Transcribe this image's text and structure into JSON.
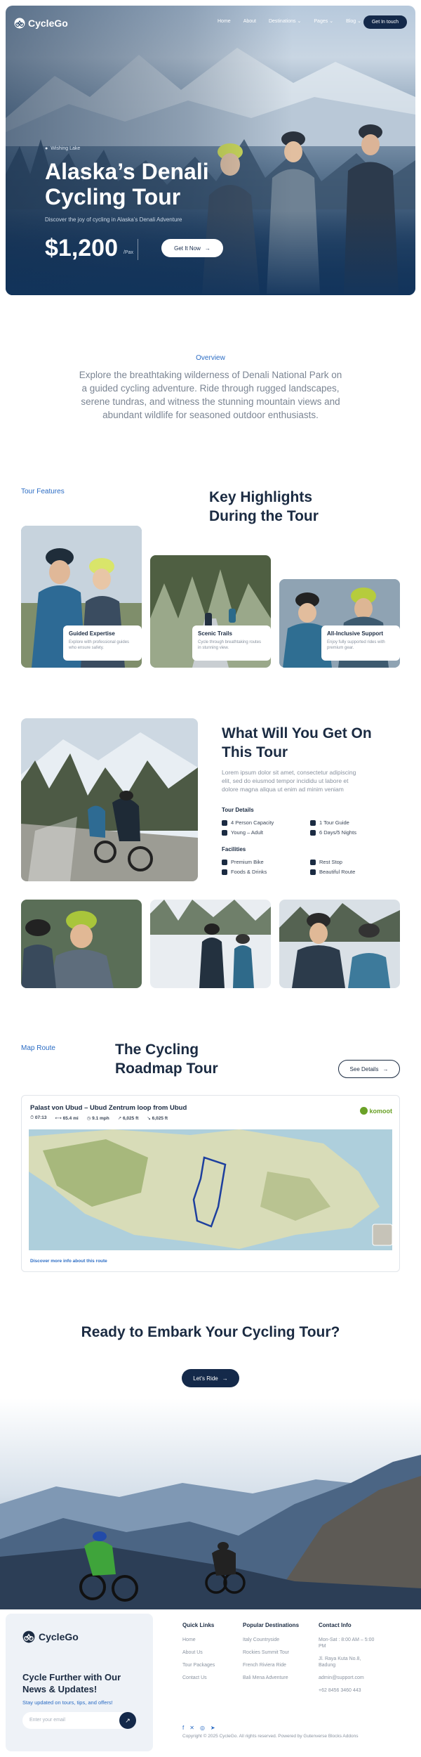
{
  "header": {
    "brand": "CycleGo",
    "nav": [
      "Home",
      "About",
      "Destinations",
      "Pages",
      "Blog"
    ],
    "cta": "Get In touch"
  },
  "hero": {
    "location": "Wishing Lake",
    "title": "Alaska’s Denali Cycling Tour",
    "subtitle": "Discover the joy of cycling in Alaska’s Denali Adventure",
    "price": "$1,200",
    "price_unit": "/Pax",
    "button": "Get It Now"
  },
  "overview": {
    "label": "Overview",
    "text": "Explore the breathtaking wilderness of Denali National Park on a guided cycling adventure. Ride through rugged landscapes, serene tundras, and witness the stunning mountain views and abundant wildlife for seasoned outdoor enthusiasts."
  },
  "features": {
    "label": "Tour Features",
    "title": "Key Highlights During the Tour",
    "cards": [
      {
        "title": "Guided Expertise",
        "desc": "Explore with professional guides who ensure safety."
      },
      {
        "title": "Scenic Trails",
        "desc": "Cycle through breathtaking routes in stunning view."
      },
      {
        "title": "All-Inclusive Support",
        "desc": "Enjoy fully supported rides with premium gear."
      }
    ]
  },
  "get": {
    "title": "What Will You Get On This Tour",
    "text": "Lorem ipsum dolor sit amet, consectetur adipiscing elit, sed do eiusmod tempor incididu ut labore et dolore magna aliqua ut enim ad minim veniam",
    "details_heading": "Tour Details",
    "details": [
      "4 Person Capacity",
      "1 Tour Guide",
      "Young – Adult",
      "6 Days/5 Nights"
    ],
    "facilities_heading": "Facilities",
    "facilities": [
      "Premium Bike",
      "Rest Stop",
      "Foods & Drinks",
      "Beautiful Route"
    ]
  },
  "map": {
    "label": "Map Route",
    "title": "The Cycling Roadmap Tour",
    "button": "See Details",
    "route_title": "Palast von Ubud – Ubud Zentrum loop from Ubud",
    "stats": [
      "07:13",
      "65.4 mi",
      "9.1 mph",
      "6,025 ft",
      "6,025 ft"
    ],
    "provider": "komoot",
    "link": "Discover more info about this route"
  },
  "cta": {
    "title": "Ready to Embark Your Cycling Tour?",
    "button": "Let’s Ride"
  },
  "footer": {
    "brand": "CycleGo",
    "headline": "Cycle Further with Our News & Updates!",
    "sub": "Stay updated on tours, tips, and offers!",
    "placeholder": "Enter your email",
    "quick_links_heading": "Quick Links",
    "quick_links": [
      "Home",
      "About Us",
      "Tour Packages",
      "Contact Us"
    ],
    "destinations_heading": "Popular Destinations",
    "destinations": [
      "Italy Countryside",
      "Rockies Summit Tour",
      "French Riviera Ride",
      "Bali Mena Adventure"
    ],
    "contact_heading": "Contact Info",
    "contact": [
      "Mon-Sat : 8:00 AM – 5:00 PM",
      "Jl. Raya Kuta No.8, Badung",
      "admin@support.com",
      "+62 8456 3460 443"
    ],
    "copyright": "Copyright © 2025 CycleGo. All rights reserved. Powered by Gutenverse Blocks Addons"
  }
}
